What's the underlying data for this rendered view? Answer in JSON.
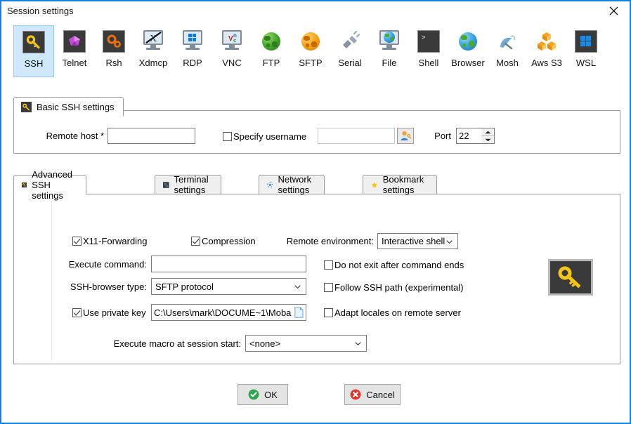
{
  "window": {
    "title": "Session settings",
    "close_icon": "close-icon",
    "accent_border": "#1a7fd4"
  },
  "protocols": {
    "selected": "SSH",
    "items": [
      {
        "label": "SSH",
        "icon": "ssh-key-icon"
      },
      {
        "label": "Telnet",
        "icon": "telnet-gem-icon"
      },
      {
        "label": "Rsh",
        "icon": "rsh-gears-icon"
      },
      {
        "label": "Xdmcp",
        "icon": "xdmcp-monitor-icon"
      },
      {
        "label": "RDP",
        "icon": "rdp-windows-monitor-icon"
      },
      {
        "label": "VNC",
        "icon": "vnc-monitor-icon"
      },
      {
        "label": "FTP",
        "icon": "ftp-globe-icon"
      },
      {
        "label": "SFTP",
        "icon": "sftp-globe-icon"
      },
      {
        "label": "Serial",
        "icon": "serial-plug-icon"
      },
      {
        "label": "File",
        "icon": "file-monitor-globe-icon"
      },
      {
        "label": "Shell",
        "icon": "shell-terminal-icon"
      },
      {
        "label": "Browser",
        "icon": "browser-globe-icon"
      },
      {
        "label": "Mosh",
        "icon": "mosh-satellite-icon"
      },
      {
        "label": "Aws S3",
        "icon": "aws-s3-boxes-icon"
      },
      {
        "label": "WSL",
        "icon": "wsl-windows-icon"
      }
    ]
  },
  "basic": {
    "tab_label": "Basic SSH settings",
    "tab_icon": "key-icon",
    "remote_host_label": "Remote host *",
    "remote_host_value": "",
    "remote_host_placeholder": "",
    "specify_username_label": "Specify username",
    "specify_username_checked": false,
    "username_value": "",
    "username_placeholder": "",
    "user_pick_icon": "user-key-icon",
    "port_label": "Port",
    "port_value": "22",
    "spin_up_icon": "spinner-up-icon",
    "spin_down_icon": "spinner-down-icon"
  },
  "tabs": [
    {
      "label": "Advanced SSH settings",
      "icon": "key-icon",
      "active": true
    },
    {
      "label": "Terminal settings",
      "icon": "terminal-icon",
      "active": false
    },
    {
      "label": "Network settings",
      "icon": "network-icon",
      "active": false
    },
    {
      "label": "Bookmark settings",
      "icon": "star-icon",
      "active": false
    }
  ],
  "advanced": {
    "x11_label": "X11-Forwarding",
    "x11_checked": true,
    "compression_label": "Compression",
    "compression_checked": true,
    "remote_env_label": "Remote environment:",
    "remote_env_value": "Interactive shell",
    "execute_command_label": "Execute command:",
    "execute_command_value": "",
    "execute_command_placeholder": "",
    "ssh_browser_label": "SSH-browser type:",
    "ssh_browser_value": "SFTP protocol",
    "use_private_key_label": "Use private key",
    "use_private_key_checked": true,
    "private_key_value": "C:\\Users\\mark\\DOCUME~1\\Moba",
    "private_key_browse_icon": "file-browse-icon",
    "do_not_exit_label": "Do not exit after command ends",
    "do_not_exit_checked": false,
    "follow_ssh_path_label": "Follow SSH path (experimental)",
    "follow_ssh_path_checked": false,
    "adapt_locales_label": "Adapt locales on remote server",
    "adapt_locales_checked": false,
    "macro_label": "Execute macro at session start:",
    "macro_value": "<none>",
    "key_graphic_icon": "key-icon"
  },
  "buttons": {
    "ok_label": "OK",
    "ok_icon": "check-circle-icon",
    "ok_color": "#2da44e",
    "cancel_label": "Cancel",
    "cancel_icon": "x-circle-icon",
    "cancel_color": "#e0352b"
  }
}
